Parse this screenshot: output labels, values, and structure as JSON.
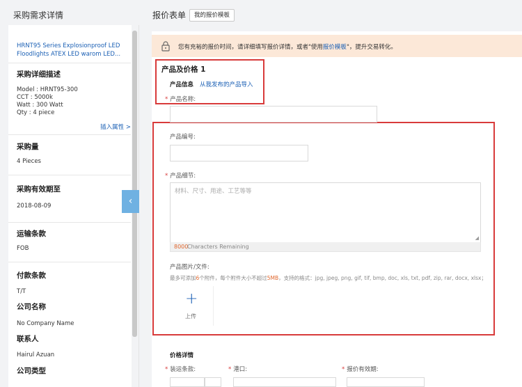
{
  "left": {
    "title": "采购需求详情",
    "product_link": "HRNT95 Series Explosionproof LED Floodlights ATEX LED warom LED...",
    "desc_title": "采购详细描述",
    "desc_lines": [
      "Model : HRNT95-300",
      "CCT : 5000k",
      "Watt : 300 Watt",
      "Qty : 4 piece"
    ],
    "insert_attr": "插入属性 >",
    "qty_title": "采购量",
    "qty_value": "4 Pieces",
    "validity_title": "采购有效期至",
    "validity_value": "2018-08-09",
    "shipping_title": "运输条款",
    "shipping_value": "FOB",
    "payment_title": "付款条款",
    "payment_value": "T/T",
    "company_title": "公司名称",
    "company_value": "No Company Name",
    "contact_title": "联系人",
    "contact_value": "Hairul Azuan",
    "company_type_title": "公司类型",
    "collapse_icon": "‹"
  },
  "right": {
    "title": "报价表单",
    "template_button": "我的报价模板",
    "notice_prefix": "您有充裕的报价时间，请详细填写报价详情，或者\"使用",
    "notice_link": "报价模板",
    "notice_suffix": "\"，提升交易转化。",
    "section_title": "产品及价格 1",
    "product_info": "产品信息",
    "import_link": "从我发布的产品导入",
    "product_name_label": "产品名称:",
    "product_code_label": "产品编号:",
    "product_detail_label": "产品细节:",
    "detail_placeholder": "材料、尺寸、用途、工艺等等",
    "chars_remaining_num": "8000",
    "chars_remaining_text": "Characters Remaining",
    "image_label": "产品图片/文件:",
    "hint_prefix": "最多可添加",
    "hint_count": "6",
    "hint_mid": "个附件，每个附件大小不超过",
    "hint_size": "5MB",
    "hint_suffix": "，支持的格式：jpg, jpeg, png, gif, tif, bmp, doc, xls, txt, pdf, zip, rar, docx, xlsx；",
    "upload_plus": "+",
    "upload_label": "上传",
    "price_title": "价格详情",
    "shipping_label": "装运条款:",
    "port_label": "港口:",
    "validity_label": "报价有效期:",
    "required_mark": "*"
  }
}
